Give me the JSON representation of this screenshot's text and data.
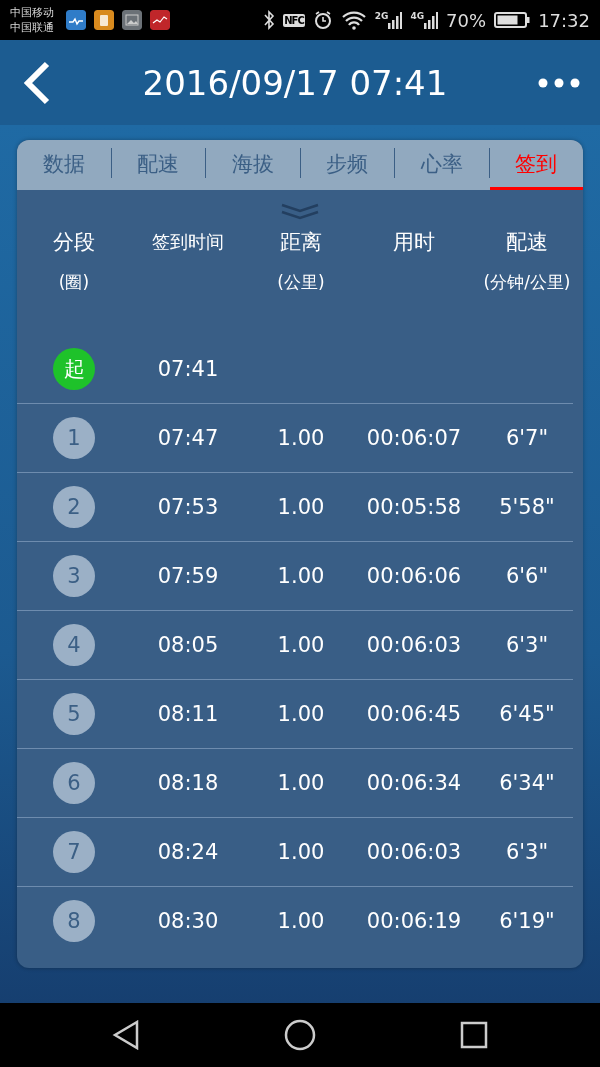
{
  "status_bar": {
    "carriers": [
      "中国移动",
      "中国联通"
    ],
    "nfc": "NFC",
    "signals": [
      "2G",
      "4G"
    ],
    "battery": "70%",
    "time": "17:32"
  },
  "header": {
    "title": "2016/09/17 07:41"
  },
  "tabs": [
    {
      "label": "数据",
      "selected": false
    },
    {
      "label": "配速",
      "selected": false
    },
    {
      "label": "海拔",
      "selected": false
    },
    {
      "label": "步频",
      "selected": false
    },
    {
      "label": "心率",
      "selected": false
    },
    {
      "label": "签到",
      "selected": true
    }
  ],
  "table": {
    "columns": [
      {
        "title": "分段",
        "unit": "(圈)"
      },
      {
        "title": "签到时间"
      },
      {
        "title": "距离",
        "unit": "(公里)"
      },
      {
        "title": "用时"
      },
      {
        "title": "配速",
        "unit": "(分钟/公里)"
      }
    ],
    "rows": [
      {
        "kind": "start",
        "lap": "起",
        "time": "07:41"
      },
      {
        "kind": "lap",
        "lap": "1",
        "time": "07:47",
        "distance": "1.00",
        "duration": "00:06:07",
        "pace": "6'7\""
      },
      {
        "kind": "lap",
        "lap": "2",
        "time": "07:53",
        "distance": "1.00",
        "duration": "00:05:58",
        "pace": "5'58\""
      },
      {
        "kind": "lap",
        "lap": "3",
        "time": "07:59",
        "distance": "1.00",
        "duration": "00:06:06",
        "pace": "6'6\""
      },
      {
        "kind": "lap",
        "lap": "4",
        "time": "08:05",
        "distance": "1.00",
        "duration": "00:06:03",
        "pace": "6'3\""
      },
      {
        "kind": "lap",
        "lap": "5",
        "time": "08:11",
        "distance": "1.00",
        "duration": "00:06:45",
        "pace": "6'45\""
      },
      {
        "kind": "lap",
        "lap": "6",
        "time": "08:18",
        "distance": "1.00",
        "duration": "00:06:34",
        "pace": "6'34\""
      },
      {
        "kind": "lap",
        "lap": "7",
        "time": "08:24",
        "distance": "1.00",
        "duration": "00:06:03",
        "pace": "6'3\""
      },
      {
        "kind": "lap",
        "lap": "8",
        "time": "08:30",
        "distance": "1.00",
        "duration": "00:06:19",
        "pace": "6'19\""
      }
    ]
  }
}
